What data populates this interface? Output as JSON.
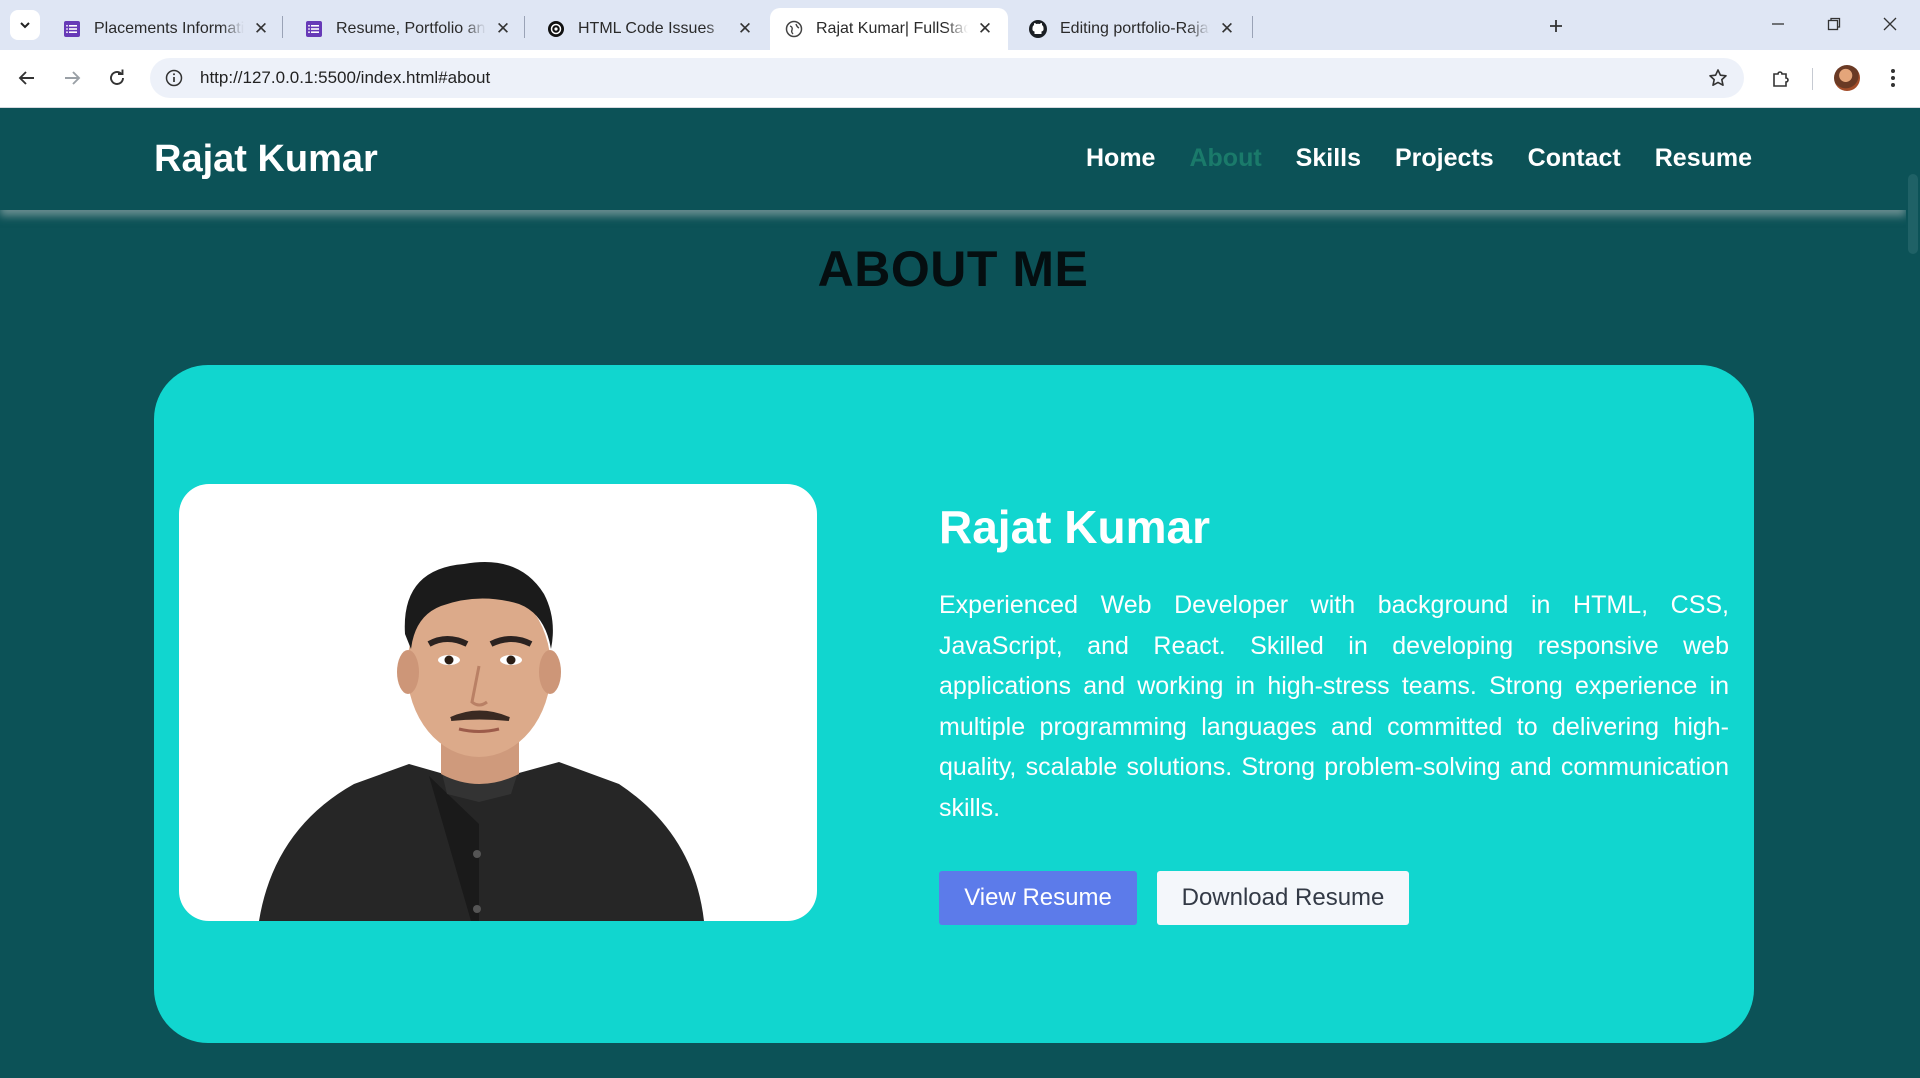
{
  "browser": {
    "tabs": [
      {
        "title": "Placements Information Form -",
        "favicon": "forms-icon",
        "active": false
      },
      {
        "title": "Resume, Portfolio and GitHub",
        "favicon": "forms-icon",
        "active": false
      },
      {
        "title": "HTML Code Issues",
        "favicon": "chatgpt-icon",
        "active": false
      },
      {
        "title": "Rajat Kumar| FullStack Develope",
        "favicon": "globe-icon",
        "active": true
      },
      {
        "title": "Editing portfolio-Rajat/READM",
        "favicon": "github-icon",
        "active": false
      }
    ],
    "url": "http://127.0.0.1:5500/index.html#about",
    "accent_color": "#dfe6f4"
  },
  "site": {
    "brand": "Rajat Kumar",
    "nav": [
      "Home",
      "About",
      "Skills",
      "Projects",
      "Contact",
      "Resume"
    ],
    "active_nav": "About",
    "colors": {
      "page_bg": "#0c5257",
      "card_bg": "#11d6cf",
      "active_nav": "#1a7a6a",
      "view_button": "#5c7bea"
    }
  },
  "about": {
    "heading": "ABOUT ME",
    "name": "Rajat Kumar",
    "bio": "Experienced Web Developer with background in HTML, CSS, JavaScript, and React. Skilled in developing responsive web applications and working in high-stress teams. Strong experience in multiple programming languages and committed to delivering high-quality, scalable solutions. Strong problem-solving and communication skills.",
    "view_button": "View Resume",
    "download_button": "Download Resume"
  }
}
